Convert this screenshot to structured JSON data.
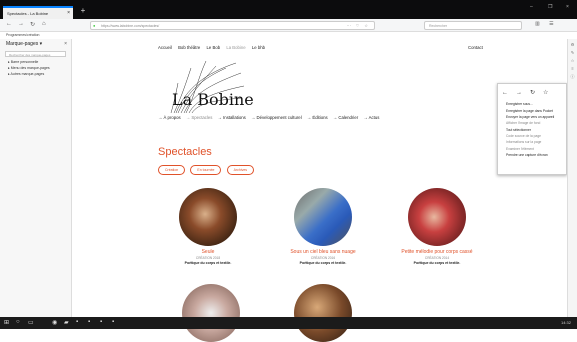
{
  "browser": {
    "tab_title": "Spectacles - La Bobine",
    "tab_close": "×",
    "new_tab": "+",
    "window_controls": [
      "–",
      "❐",
      "×"
    ],
    "url": "https://www.labobine.com/spectacles/",
    "search_placeholder": "Rechercher",
    "bookmarks_label": "Programmes/création"
  },
  "sidebar": {
    "title": "Marque-pages ▾",
    "close": "×",
    "search_placeholder": "Rechercher des marque-pages",
    "items": [
      "▸ Barre personnelle",
      "▸ Menu des marque-pages",
      "▸ Autres marque-pages"
    ]
  },
  "site": {
    "topnav": [
      "Accueil",
      "Bob théâtre",
      "Le Bob",
      "La Bobine",
      "Le bhb"
    ],
    "topnav_active": "La Bobine",
    "contact": "Contact",
    "brand": "La Bobine",
    "mainnav": [
      "→ À propos",
      "→ Spectacles",
      "→ Installations",
      "→ Développement culturel",
      "→ Éditions",
      "→ Calendrier",
      "→ Actus"
    ],
    "section_title": "Spectacles",
    "filters": [
      "Création",
      "En tournée",
      "Archives"
    ],
    "cards": [
      {
        "title": "Seule",
        "sub": "CRÉATION 2018",
        "desc": "Poétique du corps et textile."
      },
      {
        "title": "Sous un ciel bleu sans nuage",
        "sub": "CRÉATION 2016",
        "desc": "Poétique du corps et textile."
      },
      {
        "title": "Petite mélodie pour corps cassé",
        "sub": "CRÉATION 2014",
        "desc": "Poétique du corps et textile."
      }
    ]
  },
  "context_menu": {
    "items": [
      "Enregistrer sous…",
      "Enregistrer la page dans Pocket",
      "Envoyer la page vers un appareil",
      "Afficher l'image de fond",
      "Tout sélectionner",
      "Code source de la page",
      "Informations sur la page",
      "Examiner l'élément",
      "Prendre une capture d'écran"
    ]
  },
  "taskbar": {
    "clock": "14:32"
  }
}
